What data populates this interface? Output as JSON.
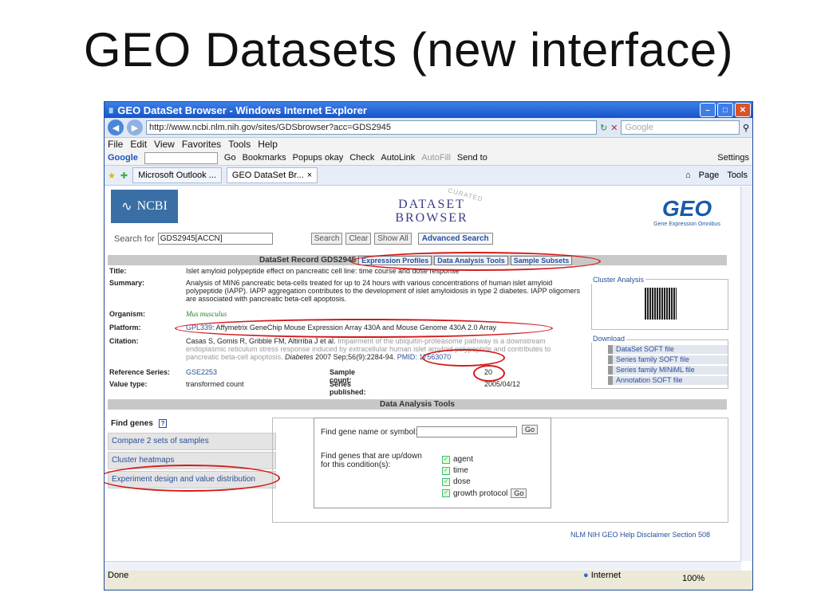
{
  "slide": {
    "title": "GEO Datasets (new interface)"
  },
  "window": {
    "title": "GEO DataSet Browser - Windows Internet Explorer",
    "url": "http://www.ncbi.nlm.nih.gov/sites/GDSbrowser?acc=GDS2945",
    "search_placeholder": "Google",
    "menu": [
      "File",
      "Edit",
      "View",
      "Favorites",
      "Tools",
      "Help"
    ],
    "google_toolbar": {
      "logo": "Google",
      "go": "Go",
      "bookmarks": "Bookmarks",
      "popups": "Popups okay",
      "check": "Check",
      "autolink": "AutoLink",
      "autofill": "AutoFill",
      "sendto": "Send to",
      "settings": "Settings"
    },
    "tabs": [
      "Microsoft Outlook ...",
      "GEO DataSet Br..."
    ],
    "tools_right": {
      "page": "Page",
      "tools": "Tools"
    },
    "status": {
      "left": "Done",
      "zone": "Internet",
      "zoom": "100%"
    }
  },
  "header": {
    "ncbi": "NCBI",
    "dataset_title_1": "DATASET",
    "dataset_title_2": "BROWSER",
    "curated": "CURATED",
    "geo": "GEO",
    "geo_sub": "Gene Expression Omnibus"
  },
  "search": {
    "label": "Search for",
    "value": "GDS2945[ACCN]",
    "buttons": {
      "search": "Search",
      "clear": "Clear",
      "show_all": "Show All"
    },
    "advanced": "Advanced Search"
  },
  "record": {
    "label": "DataSet Record GDS2945",
    "tabs": [
      "Expression Profiles",
      "Data Analysis Tools",
      "Sample Subsets"
    ],
    "title_lbl": "Title:",
    "title_val": "Islet amyloid polypeptide effect on pancreatic cell line: time course and dose response",
    "summary_lbl": "Summary:",
    "summary_val": "Analysis of MIN6 pancreatic beta-cells treated for up to 24 hours with various concentrations of human islet amyloid polypeptide (IAPP). IAPP aggregation contributes to the development of islet amyloidosis in type 2 diabetes. IAPP oligomers are associated with pancreatic beta-cell apoptosis.",
    "organism_lbl": "Organism:",
    "organism_val": "Mus musculus",
    "platform_lbl": "Platform:",
    "platform_link": "GPL339",
    "platform_val": ": Affymetrix GeneChip Mouse Expression Array 430A and Mouse Genome 430A 2.0 Array",
    "citation_lbl": "Citation:",
    "citation_authors": "Casas S, Gomis R, Gribble FM, Altirriba J et al.",
    "citation_title": "Impairment of the ubiquitin-proteasome pathway is a downstream endoplasmic reticulum stress response induced by extracellular human islet amyloid polypeptide and contributes to pancreatic beta-cell apoptosis.",
    "citation_journal": "Diabetes",
    "citation_ref": "2007 Sep;56(9):2284-94.",
    "pmid": "PMID: 17563070",
    "refseries_lbl": "Reference Series:",
    "refseries_val": "GSE2253",
    "sample_count_lbl": "Sample count:",
    "sample_count_val": "20",
    "value_type_lbl": "Value type:",
    "value_type_val": "transformed count",
    "published_lbl": "Series published:",
    "published_val": "2005/04/12"
  },
  "side_boxes": {
    "cluster_lbl": "Cluster Analysis",
    "download_lbl": "Download",
    "downloads": [
      "DataSet SOFT file",
      "Series family SOFT file",
      "Series family MINiML file",
      "Annotation SOFT file"
    ]
  },
  "tools": {
    "bar": "Data Analysis Tools",
    "find_genes": "Find genes",
    "help": "?",
    "items": [
      "Compare 2 sets of samples",
      "Cluster heatmaps",
      "Experiment design and value distribution"
    ],
    "find_symbol_lbl": "Find gene name or symbol:",
    "go": "Go",
    "updown_lbl": "Find genes that are up/down for this condition(s):",
    "conditions": [
      "agent",
      "time",
      "dose",
      "growth protocol"
    ]
  },
  "footer": {
    "links": "NLM  NIH  GEO Help  Disclaimer  Section 508"
  }
}
